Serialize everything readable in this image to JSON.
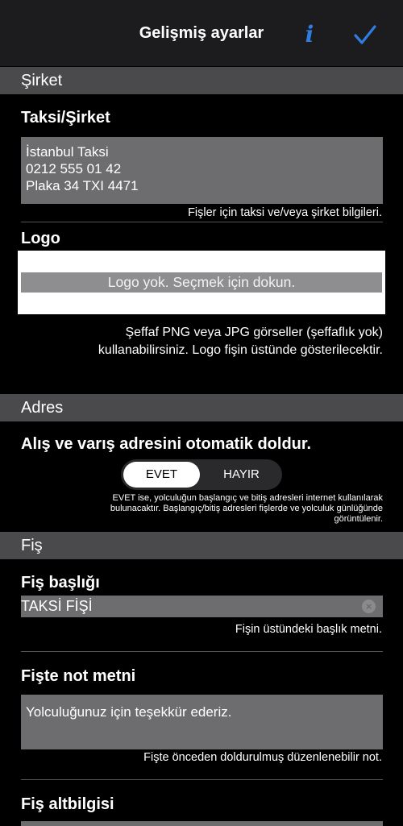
{
  "navbar": {
    "title": "Gelişmiş ayarlar",
    "info_icon": "info-icon",
    "done_icon": "checkmark-icon",
    "accent_color": "#2f7de1"
  },
  "sections": {
    "company": "Şirket",
    "address": "Adres",
    "receipt": "Fiş"
  },
  "company": {
    "taxi_label": "Taksi/Şirket",
    "taxi_lines": [
      "İstanbul Taksi",
      "0212 555 01 42",
      "Plaka 34 TXI 4471"
    ],
    "taxi_help": "Fişler için taksi ve/veya şirket bilgileri.",
    "logo_label": "Logo",
    "logo_placeholder": "Logo yok. Seçmek için dokun.",
    "logo_help_line1": "Şeffaf PNG veya JPG görseller (şeffaflık yok)",
    "logo_help_line2": "kullanabilirsiniz. Logo fişin üstünde gösterilecektir."
  },
  "address": {
    "autofill_label": "Alış ve varış adresini otomatik doldur.",
    "option_yes": "EVET",
    "option_no": "HAYIR",
    "selected": "EVET",
    "help_line1": "EVET ise, yolculuğun başlangıç ve bitiş adresleri internet kullanılarak",
    "help_line2": "bulunacaktır. Başlangıç/bitiş adresleri fişlerde ve yolculuk günlüğünde",
    "help_line3": "görüntülenir."
  },
  "receipt": {
    "title_label": "Fiş başlığı",
    "title_value": "TAKSİ FİŞİ",
    "title_help": "Fişin üstündeki başlık metni.",
    "note_label": "Fişte not metni",
    "note_value": "Yolculuğunuz için teşekkür ederiz.",
    "note_help": "Fişte önceden doldurulmuş düzenlenebilir not.",
    "footer_label": "Fiş altbilgisi"
  }
}
